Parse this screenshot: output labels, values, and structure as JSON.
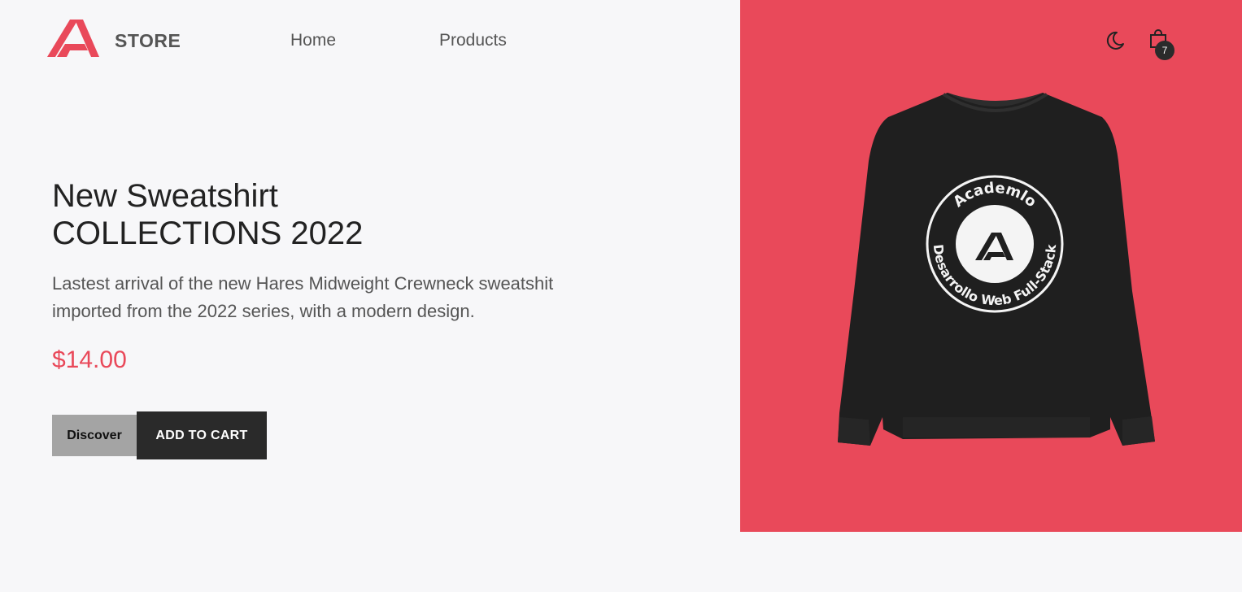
{
  "header": {
    "brand": "STORE",
    "nav": {
      "home": "Home",
      "products": "Products"
    },
    "cart_count": "7"
  },
  "hero": {
    "headline_line1": "New Sweatshirt",
    "headline_line2": "COLLECTIONS 2022",
    "description": "Lastest arrival of the new Hares Midweight Crewneck sweatshit imported from the 2022 series, with a modern design.",
    "price": "$14.00",
    "discover_label": "Discover",
    "add_to_cart_label": "ADD TO CART"
  },
  "product_image": {
    "badge_top": "Academlo",
    "badge_bottom": "Desarrollo Web Full-Stack"
  },
  "icons": {
    "logo": "academlo-logo-icon",
    "theme": "moon-icon",
    "cart": "shopping-bag-icon"
  },
  "colors": {
    "accent": "#e9495a",
    "dark": "#2a2a2a",
    "background": "#f7f7f9"
  }
}
